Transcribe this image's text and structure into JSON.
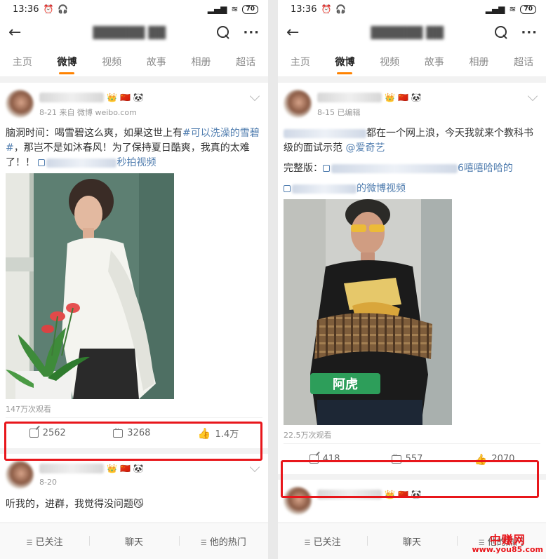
{
  "left": {
    "status": {
      "time": "13:36",
      "battery": "70"
    },
    "tabs": [
      "主页",
      "微博",
      "视频",
      "故事",
      "相册",
      "超话"
    ],
    "post1": {
      "date_source": "8-21  来自 微博 weibo.com",
      "text_plain1": "脑洞时间：喝雪碧这么爽，如果这世上有",
      "hashtag": "#可以洗澡的雪碧#",
      "text_plain2": "，那岂不是如沐春风！为了保持夏日酷爽，我真的太难了！！",
      "video_link": "秒拍视频",
      "views": "147万次观看",
      "reposts": "2562",
      "comments": "3268",
      "likes": "1.4万"
    },
    "post2": {
      "date": "8-20",
      "text": "听我的，进群，我觉得没问题😼"
    },
    "bottom": [
      "已关注",
      "聊天",
      "他的热门"
    ]
  },
  "right": {
    "status": {
      "time": "13:36",
      "battery": "70"
    },
    "tabs": [
      "主页",
      "微博",
      "视频",
      "故事",
      "相册",
      "超话"
    ],
    "post1": {
      "date_source": "8-15  已编辑",
      "text_plain1": "都在一个网上浪，今天我就来个教科书级的面试示范",
      "mention": "@爱奇艺",
      "full_label": "完整版：",
      "full_link_tail": "6嘻嘻哈哈的",
      "video_link_tail": "的微博视频",
      "name_tag": "阿虎",
      "views": "22.5万次观看",
      "reposts": "418",
      "comments": "557",
      "likes": "2070"
    },
    "bottom": [
      "已关注",
      "聊天",
      "他的热门"
    ]
  },
  "watermark": {
    "top": "中赚网",
    "bottom": "www.you85.com"
  },
  "colors": {
    "accent": "#ff8200",
    "highlight": "#e8161b",
    "link": "#507daf"
  }
}
